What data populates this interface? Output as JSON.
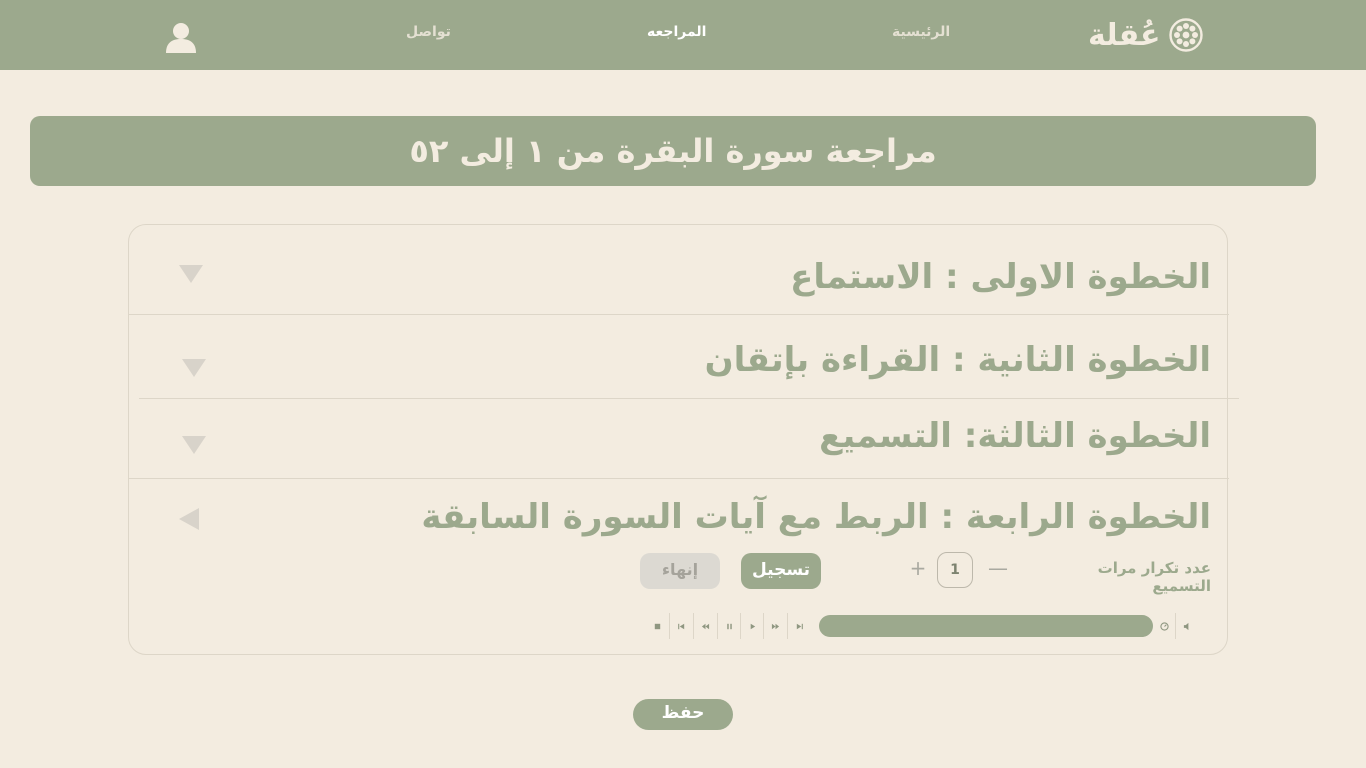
{
  "header": {
    "brand_name": "عُقلة",
    "nav": {
      "home": "الرئيسية",
      "review": "المراجعه",
      "contact": "تواصل"
    }
  },
  "banner": {
    "title": "مراجعة سورة البقرة من ١ إلى ٥٢"
  },
  "steps": [
    {
      "title": "الخطوة الاولى : الاستماع",
      "state": "collapsed"
    },
    {
      "title": "الخطوة الثانية : القراءة بإتقان",
      "state": "collapsed"
    },
    {
      "title": "الخطوة الثالثة: التسميع",
      "state": "collapsed"
    },
    {
      "title": "الخطوة الرابعة : الربط مع آيات السورة السابقة",
      "state": "expanded"
    }
  ],
  "controls": {
    "repeat_label": "عدد تكرار مرات التسميع",
    "minus": "—",
    "plus": "+",
    "count": "1",
    "record_label": "تسجيل",
    "finish_label": "إنهاء"
  },
  "save_label": "حفظ",
  "colors": {
    "accent": "#9ca98d",
    "background": "#f3ece0",
    "muted": "#d8d3ca"
  },
  "icons": [
    "flower-logo-icon",
    "user-avatar-icon",
    "chevron-down-icon",
    "chevron-left-icon",
    "volume-icon",
    "speed-icon",
    "skip-next-icon",
    "fast-forward-icon",
    "play-icon",
    "pause-icon",
    "rewind-icon",
    "skip-previous-icon",
    "stop-icon"
  ]
}
